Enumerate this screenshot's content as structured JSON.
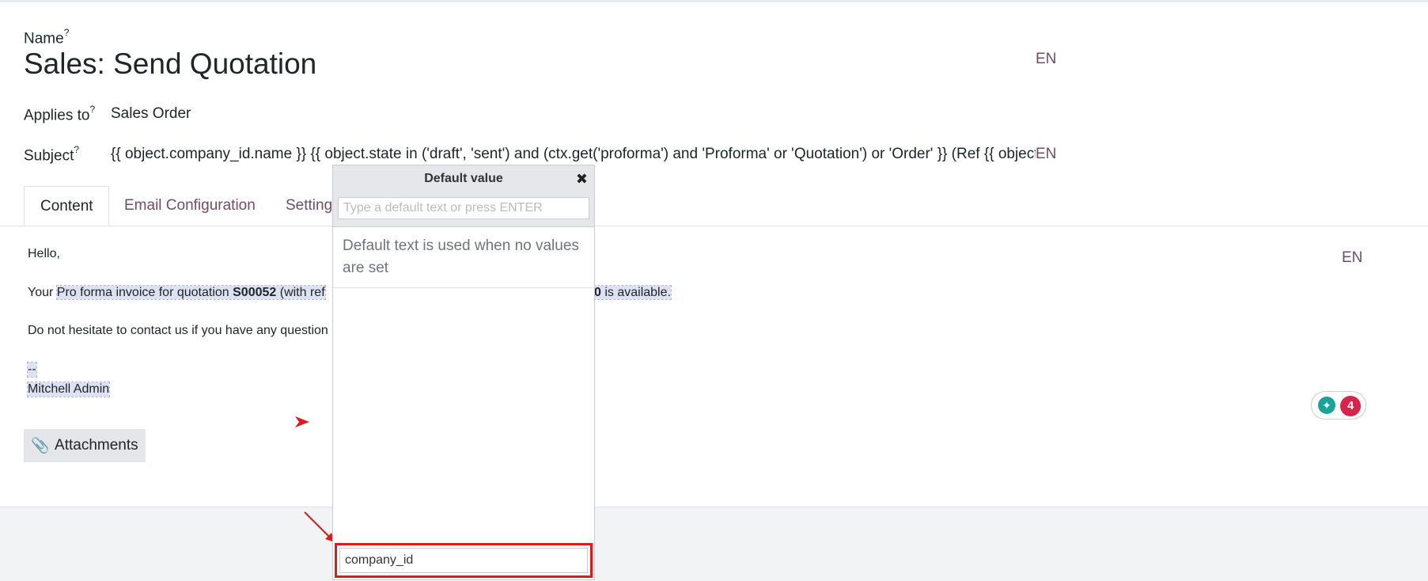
{
  "form": {
    "name_label": "Name",
    "tooltip_mark": "?",
    "name_value": "Sales: Send Quotation",
    "lang": "EN",
    "applies_label": "Applies to",
    "applies_value": "Sales Order",
    "subject_label": "Subject",
    "subject_value": "{{ object.company_id.name }} {{ object.state in ('draft', 'sent') and (ctx.get('proforma') and 'Proforma' or 'Quotation') or 'Order' }} (Ref {{ object.r"
  },
  "tabs": [
    {
      "label": "Content"
    },
    {
      "label": "Email Configuration"
    },
    {
      "label": "Setting"
    }
  ],
  "body": {
    "hello": "Hello,",
    "your": "Your ",
    "proforma_text": "Pro forma invoice for ",
    "quotation_text": "quotation ",
    "order_ref": "S00052",
    "with_ref": " (with ref",
    "tail_bold": "0",
    "available": " is available.",
    "hesitate": "Do not hesitate to contact us if you have any question",
    "dash": "--",
    "signature": "Mitchell Admin",
    "attachments_label": "Attachments"
  },
  "popover": {
    "title": "Default value",
    "input_placeholder": "Type a default text or press ENTER",
    "description": "Default text is used when no values are set",
    "path_value": "company_id"
  },
  "assistant": {
    "count": "4"
  },
  "colors": {
    "accent": "#714B67",
    "highlight": "#e01a1a"
  }
}
